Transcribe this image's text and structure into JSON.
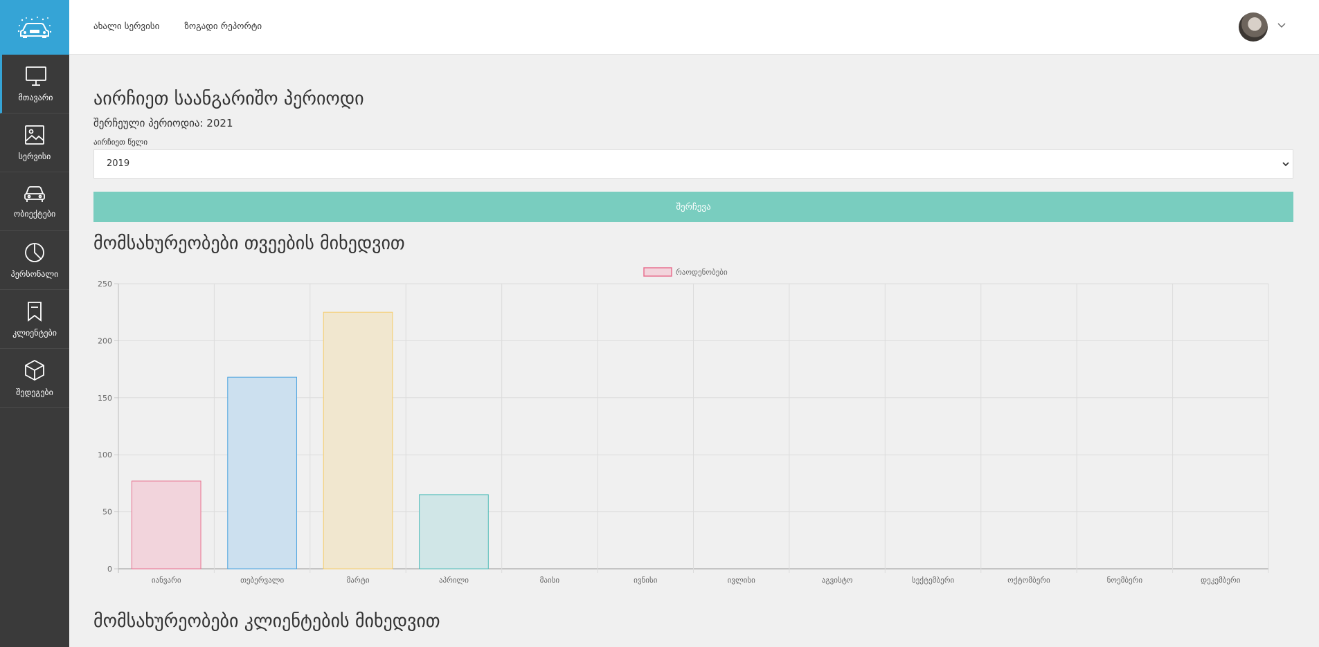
{
  "sidebar": {
    "items": [
      {
        "label": "მთავარი",
        "icon": "monitor-icon",
        "active": true
      },
      {
        "label": "სერვისი",
        "icon": "image-icon",
        "active": false
      },
      {
        "label": "ობიექტები",
        "icon": "car-icon",
        "active": false
      },
      {
        "label": "პერსონალი",
        "icon": "pie-chart-icon",
        "active": false
      },
      {
        "label": "კლიენტები",
        "icon": "bookmark-icon",
        "active": false
      },
      {
        "label": "შედეგები",
        "icon": "box-icon",
        "active": false
      }
    ]
  },
  "header": {
    "links": [
      "ახალი სერვისი",
      "ზოგადი რეპორტი"
    ]
  },
  "main": {
    "title": "აირჩიეთ საანგარიშო პერიოდი",
    "selected_period": "შერჩეული პერიოდია: 2021",
    "select_label": "აირჩიეთ წელი",
    "select_value": "2019",
    "button_label": "შერჩევა",
    "section1_title": "მომსახურეობები თვეების მიხედვით",
    "section2_title": "მომსახურეობები კლიენტების მიხედვით"
  },
  "colors": {
    "sidebar_bg": "#3a3a3a",
    "brand_bg": "#35a4d6",
    "button_bg": "#79cdbf",
    "bar_fills": [
      "#f2d4dc",
      "#cce0ef",
      "#f1e7cf",
      "#d0e6e7"
    ],
    "bar_strokes": [
      "#e8718f",
      "#4aa3df",
      "#f5cc6c",
      "#51bcb9"
    ]
  },
  "chart_data": {
    "type": "bar",
    "categories": [
      "იანვარი",
      "თებერვალი",
      "მარტი",
      "აპრილი",
      "მაისი",
      "ივნისი",
      "ივლისი",
      "აგვისტო",
      "სექტემბერი",
      "ოქტომბერი",
      "ნოემბერი",
      "დეკემბერი"
    ],
    "series": [
      {
        "name": "რაოდენობები",
        "values": [
          77,
          168,
          225,
          65,
          0,
          0,
          0,
          0,
          0,
          0,
          0,
          0
        ]
      }
    ],
    "ylim": [
      0,
      250
    ],
    "yticks": [
      0,
      50,
      100,
      150,
      200,
      250
    ],
    "grid": true,
    "legend": "top-center"
  }
}
